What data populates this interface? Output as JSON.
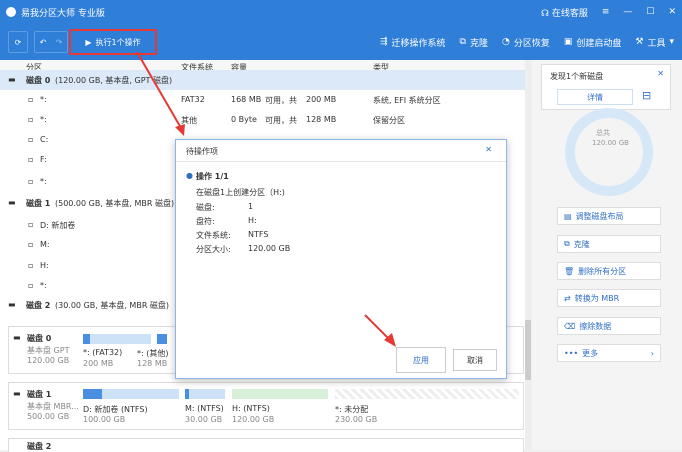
{
  "app": {
    "title": "易我分区大师 专业版"
  },
  "titlebar_right": {
    "support": "在线客服"
  },
  "toolbar": {
    "execute_label": "执行1个操作",
    "tools": [
      {
        "label": "迁移操作系统",
        "icon": "migrate-icon"
      },
      {
        "label": "克隆",
        "icon": "clone-icon"
      },
      {
        "label": "分区恢复",
        "icon": "recover-icon"
      },
      {
        "label": "创建启动盘",
        "icon": "bootdisk-icon"
      },
      {
        "label": "工具",
        "icon": "tools-icon"
      }
    ]
  },
  "columns": [
    "分区",
    "文件系统",
    "容量",
    "类型"
  ],
  "disks": [
    {
      "label": "磁盘 0",
      "info": "(120.00 GB, 基本盘, GPT 磁盘)"
    },
    {
      "label": "磁盘 1",
      "info": "(500.00 GB, 基本盘, MBR 磁盘)"
    },
    {
      "label": "磁盘 2",
      "info": "(30.00 GB, 基本盘, MBR 磁盘)"
    }
  ],
  "partitions": [
    {
      "name": "*:",
      "fs": "FAT32",
      "cap": "168 MB",
      "avail": "可用，共",
      "total": "200 MB",
      "type": "系统, EFI 系统分区"
    },
    {
      "name": "*:",
      "fs": "其他",
      "cap": "0 Byte",
      "avail": "可用，共",
      "total": "128 MB",
      "type": "保留分区"
    },
    {
      "name": "C:",
      "fs": "",
      "cap": "",
      "avail": "",
      "total": "",
      "type": ""
    },
    {
      "name": "F:",
      "fs": "",
      "cap": "",
      "avail": "",
      "total": "",
      "type": ""
    },
    {
      "name": "*:",
      "fs": "",
      "cap": "",
      "avail": "",
      "total": "",
      "type": ""
    },
    {
      "name": "D: 新加卷",
      "fs": "",
      "cap": "",
      "avail": "",
      "total": "",
      "type": ""
    },
    {
      "name": "M:",
      "fs": "",
      "cap": "",
      "avail": "",
      "total": "",
      "type": ""
    },
    {
      "name": "H:",
      "fs": "",
      "cap": "",
      "avail": "",
      "total": "",
      "type": ""
    },
    {
      "name": "*:",
      "fs": "",
      "cap": "",
      "avail": "",
      "total": "",
      "type": ""
    }
  ],
  "disk_maps": [
    {
      "name": "磁盘 0",
      "sub1": "基本盘 GPT",
      "sub2": "120.00 GB",
      "segments": [
        {
          "label": "*: (FAT32)",
          "size": "200 MB"
        },
        {
          "label": "*: (其他)",
          "size": "128 MB"
        }
      ]
    },
    {
      "name": "磁盘 1",
      "sub1": "基本盘 MBR...",
      "sub2": "500.00 GB",
      "segments": [
        {
          "label": "D: 新加卷 (NTFS)",
          "size": "100.00 GB"
        },
        {
          "label": "M: (NTFS)",
          "size": "30.00 GB"
        },
        {
          "label": "H: (NTFS)",
          "size": "120.00 GB"
        },
        {
          "label": "*: 未分配",
          "size": "230.00 GB"
        }
      ]
    },
    {
      "name": "磁盘 2",
      "sub1": "",
      "sub2": "",
      "segments": []
    }
  ],
  "sidebar": {
    "notice": "发现1个新磁盘",
    "detail_label": "详情",
    "donut_label": "总共",
    "donut_value": "120.00 GB",
    "actions": [
      {
        "label": "调整磁盘布局",
        "icon": "layout-icon"
      },
      {
        "label": "克隆",
        "icon": "clone-icon"
      },
      {
        "label": "删除所有分区",
        "icon": "delete-icon"
      },
      {
        "label": "转换为 MBR",
        "icon": "convert-icon"
      },
      {
        "label": "擦除数据",
        "icon": "wipe-icon"
      },
      {
        "label": "更多",
        "icon": "more-icon"
      }
    ]
  },
  "dialog": {
    "title": "待操作项",
    "op_title": "操作 1/1",
    "op_desc": "在磁盘1上创建分区（H:)",
    "fields": [
      {
        "k": "磁盘:",
        "v": "1"
      },
      {
        "k": "盘符:",
        "v": "H:"
      },
      {
        "k": "文件系统:",
        "v": "NTFS"
      },
      {
        "k": "分区大小:",
        "v": "120.00 GB"
      }
    ],
    "apply_label": "应用",
    "cancel_label": "取消"
  },
  "colors": {
    "accent": "#2f7ed8",
    "highlight": "#e53935"
  }
}
